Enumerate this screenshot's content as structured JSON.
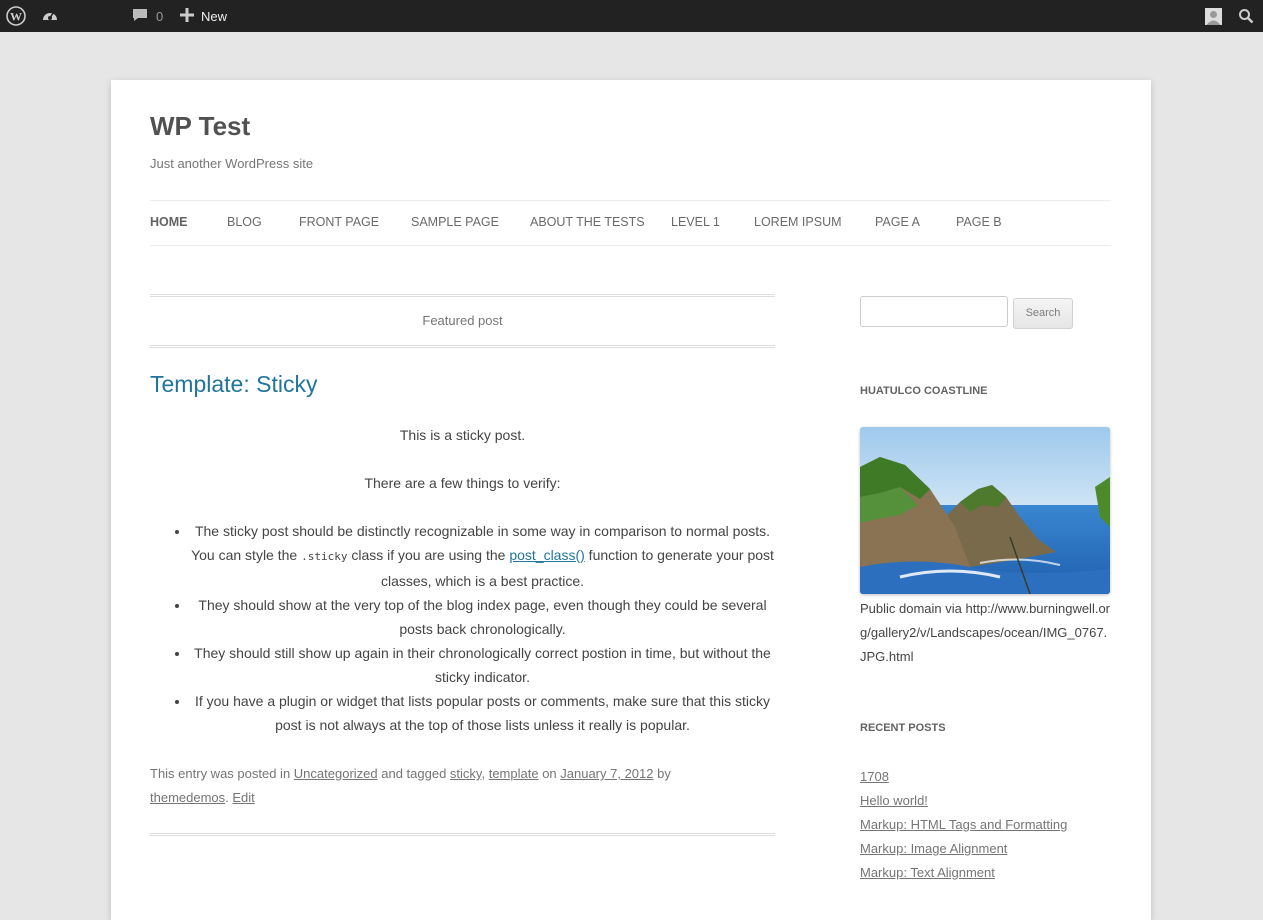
{
  "admin_bar": {
    "comments_count": "0",
    "new_label": "New"
  },
  "site": {
    "title": "WP Test",
    "description": "Just another WordPress site"
  },
  "nav": {
    "items": [
      {
        "label": "HOME",
        "current": true
      },
      {
        "label": "BLOG"
      },
      {
        "label": "FRONT PAGE"
      },
      {
        "label": "SAMPLE PAGE"
      },
      {
        "label": "ABOUT THE TESTS"
      },
      {
        "label": "LEVEL 1"
      },
      {
        "label": "LOREM IPSUM"
      },
      {
        "label": "PAGE A"
      },
      {
        "label": "PAGE B"
      }
    ]
  },
  "post": {
    "featured_label": "Featured post",
    "title": "Template: Sticky",
    "intro": "This is a sticky post.",
    "verify_intro": "There are a few things to verify:",
    "bullet1_before": "The sticky post should be distinctly recognizable in some way in comparison to normal posts. You can style the ",
    "bullet1_code": ".sticky",
    "bullet1_mid": " class if you are using the ",
    "bullet1_link": "post_class()",
    "bullet1_after": " function to generate your post classes, which is a best practice.",
    "bullet2": "They should show at the very top of the blog index page, even though they could be several posts back chronologically.",
    "bullet3": "They should still show up again in their chronologically correct postion in time, but without the sticky indicator.",
    "bullet4": "If you have a plugin or widget that lists popular posts or comments, make sure that this sticky post is not always at the top of those lists unless it really is popular.",
    "meta": {
      "posted_in_text": "This entry was posted in ",
      "category": "Uncategorized",
      "tagged_text": " and tagged ",
      "tag1": "sticky",
      "comma": ", ",
      "tag2": "template",
      "on_text": " on ",
      "date": "January 7, 2012",
      "by_text": " by ",
      "author": "themedemos",
      "period": ". ",
      "edit": "Edit"
    }
  },
  "sidebar": {
    "search_button": "Search",
    "image_widget": {
      "title": "HUATULCO COASTLINE",
      "caption": "Public domain via http://www.burningwell.org/gallery2/v/Landscapes/ocean/IMG_0767.JPG.html"
    },
    "recent_posts": {
      "title": "RECENT POSTS",
      "items": [
        "1708",
        "Hello world!",
        "Markup: HTML Tags and Formatting",
        "Markup: Image Alignment",
        "Markup: Text Alignment"
      ]
    }
  }
}
